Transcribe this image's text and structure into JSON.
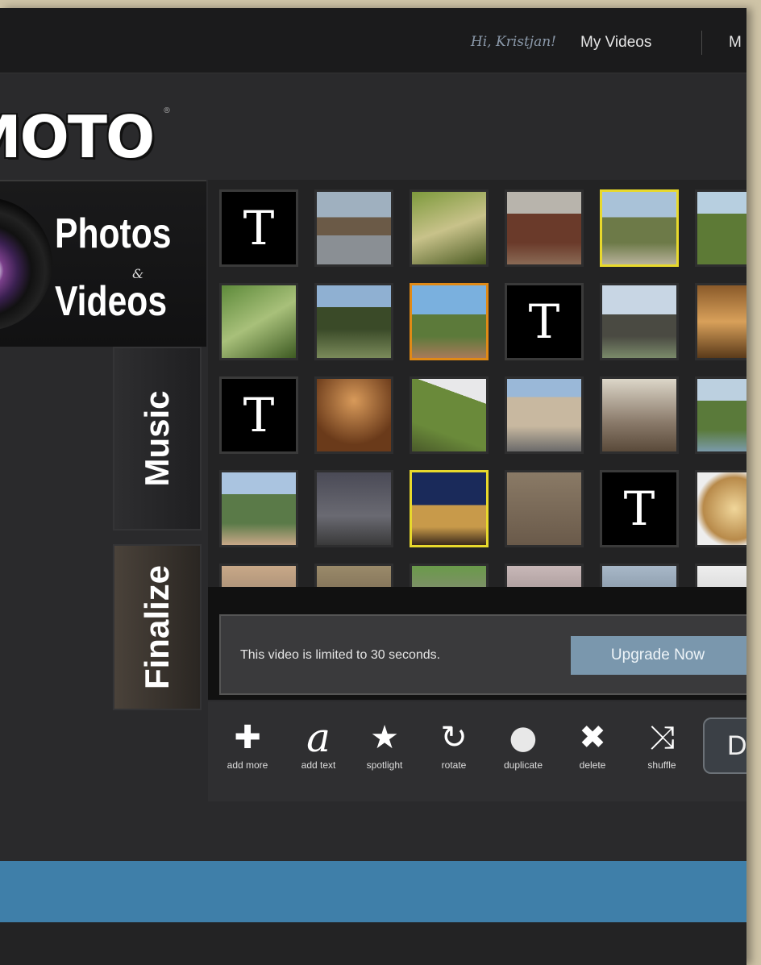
{
  "header": {
    "greeting": "Hi, Kristjan!",
    "nav": [
      "My Videos",
      "M"
    ]
  },
  "brand": {
    "logo_text": "MOTO",
    "logo_mark": "®"
  },
  "sidebar": {
    "photos_title": "Photos",
    "amp": "&",
    "videos_title": "Videos",
    "music_tab": "Music",
    "finalize_tab": "Finalize"
  },
  "grid": {
    "text_glyph": "T"
  },
  "limit_notice": {
    "text": "This video is limited to 30 seconds.",
    "upgrade_label": "Upgrade Now"
  },
  "toolbar": {
    "tools": [
      {
        "label": "add more",
        "icon": "plus-icon",
        "glyph": "✚"
      },
      {
        "label": "add text",
        "icon": "text-a-icon",
        "glyph": "a"
      },
      {
        "label": "spotlight",
        "icon": "star-icon",
        "glyph": "★"
      },
      {
        "label": "rotate",
        "icon": "rotate-icon",
        "glyph": "↻"
      },
      {
        "label": "duplicate",
        "icon": "duplicate-icon",
        "glyph": "●"
      },
      {
        "label": "delete",
        "icon": "delete-icon",
        "glyph": "✖"
      },
      {
        "label": "shuffle",
        "icon": "shuffle-icon",
        "glyph": "⤨"
      }
    ],
    "done_label": "Do"
  },
  "colors": {
    "accent_blue": "#3f7fa9",
    "upgrade_button": "#7a97ad",
    "selected_yellow": "#e8d92c",
    "selected_orange": "#e08a16"
  }
}
